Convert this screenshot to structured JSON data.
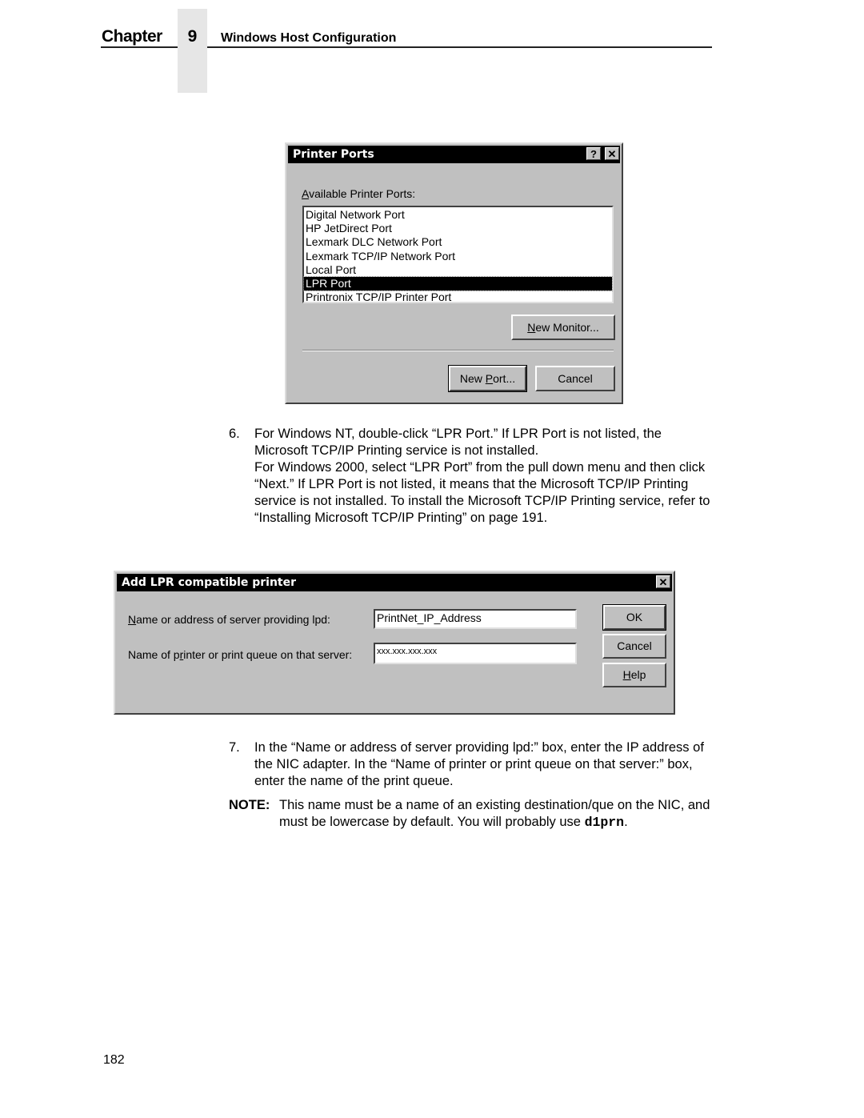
{
  "header": {
    "chapter_label": "Chapter",
    "chapter_number": "9",
    "chapter_title": "Windows Host Configuration"
  },
  "printer_ports_dialog": {
    "title": "Printer Ports",
    "help_button": "?",
    "close_button": "✕",
    "list_label_access_key": "A",
    "list_label_rest": "vailable Printer Ports:",
    "ports": [
      "Digital Network Port",
      "HP JetDirect Port",
      "Lexmark DLC Network Port",
      "Lexmark TCP/IP Network Port",
      "Local Port",
      "LPR Port",
      "Printronix TCP/IP Printer Port"
    ],
    "selected_port": "LPR Port",
    "new_monitor_key": "N",
    "new_monitor_rest": "ew Monitor...",
    "new_port_pre": "New ",
    "new_port_key": "P",
    "new_port_rest": "ort...",
    "cancel": "Cancel"
  },
  "step6": {
    "number": "6.",
    "line1": "For Windows NT, double-click “LPR Port.” If LPR Port is not listed, the Microsoft TCP/IP Printing service is not installed.",
    "line2": "For Windows 2000, select “LPR Port” from the pull down menu and then click “Next.” If LPR Port is not listed, it means that the Microsoft TCP/IP Printing service is not installed. To install the Microsoft TCP/IP Printing service, refer to “Installing Microsoft TCP/IP Printing” on page 191."
  },
  "lpr_dialog": {
    "title": "Add LPR compatible printer",
    "close_button": "✕",
    "server_label_key": "N",
    "server_label_rest": "ame or address of server providing lpd:",
    "server_value": "PrintNet_IP_Address",
    "queue_label_pre": "Name of p",
    "queue_label_key": "r",
    "queue_label_rest": "inter or print queue on that server:",
    "queue_value": "xxx.xxx.xxx.xxx",
    "ok": "OK",
    "cancel": "Cancel",
    "help_key": "H",
    "help_rest": "elp"
  },
  "step7": {
    "number": "7.",
    "text": "In the “Name or address of server providing lpd:” box, enter the IP address of the NIC adapter. In the “Name of printer or print queue on that server:” box, enter the name of the print queue."
  },
  "note": {
    "label": "NOTE:",
    "text": "This name must be a name of an existing destination/que on the NIC, and must be lowercase by default. You will probably use ",
    "code": "d1prn",
    "end": "."
  },
  "footer": {
    "page_number": "182"
  }
}
